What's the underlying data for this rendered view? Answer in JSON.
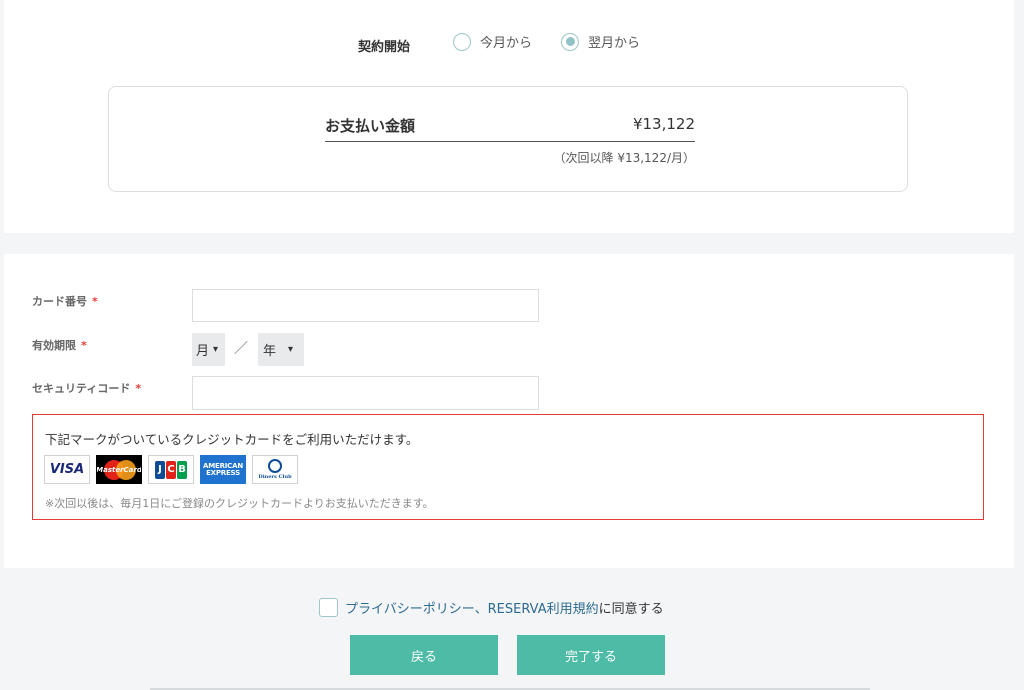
{
  "contract": {
    "label": "契約開始",
    "options": [
      {
        "label": "今月から",
        "selected": false
      },
      {
        "label": "翌月から",
        "selected": true
      }
    ]
  },
  "payment": {
    "title": "お支払い金額",
    "amount": "¥13,122",
    "next": "（次回以降 ¥13,122/月）"
  },
  "card_form": {
    "card_number_label": "カード番号",
    "expiry_label": "有効期限",
    "security_code_label": "セキュリティコード",
    "required_mark": "*",
    "month_select": "月",
    "year_select": "年",
    "separator": "／"
  },
  "card_notice": {
    "text": "下記マークがついているクレジットカードをご利用いただけます。",
    "note": "※次回以後は、毎月1日にご登録のクレジットカードよりお支払いただきます。",
    "brands": {
      "visa": "VISA",
      "mastercard": "MasterCard",
      "jcb": [
        "J",
        "C",
        "B"
      ],
      "amex_line1": "AMERICAN",
      "amex_line2": "EXPRESS",
      "diners": "Diners Club"
    }
  },
  "agreement": {
    "link_text": "プライバシーポリシー、RESERVA利用規約",
    "suffix": "に同意する"
  },
  "buttons": {
    "back": "戻る",
    "complete": "完了する"
  },
  "colors": {
    "accent": "#4dbba6",
    "required": "#e53935",
    "radio": "#8fc3c6",
    "link": "#2e6b90"
  }
}
